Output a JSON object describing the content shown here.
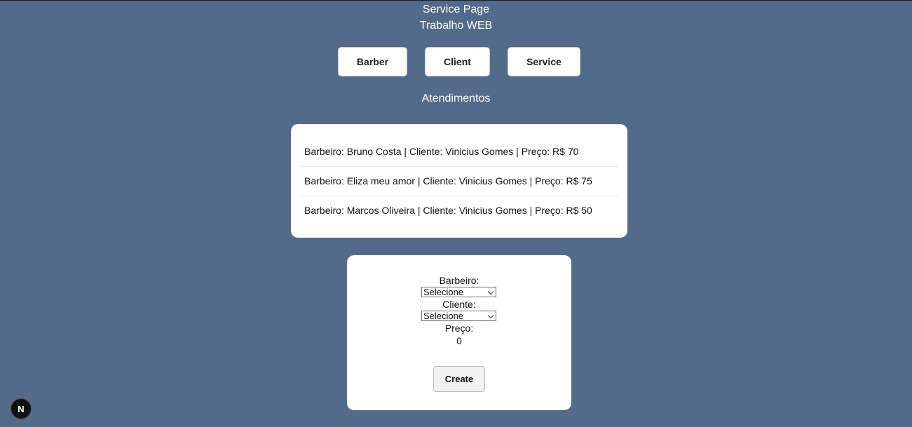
{
  "header": {
    "page_title": "Service Page",
    "subtitle": "Trabalho WEB"
  },
  "nav": {
    "barber_label": "Barber",
    "client_label": "Client",
    "service_label": "Service"
  },
  "section": {
    "title": "Atendimentos"
  },
  "services": [
    "Barbeiro: Bruno Costa | Cliente: Vinicius Gomes | Preço: R$ 70",
    "Barbeiro: Eliza meu amor | Cliente: Vinicius Gomes | Preço: R$ 75",
    "Barbeiro: Marcos Oliveira | Cliente: Vinicius Gomes | Preço: R$ 50"
  ],
  "form": {
    "barbeiro_label": "Barbeiro:",
    "barbeiro_selected": "Selecione",
    "cliente_label": "Cliente:",
    "cliente_selected": "Selecione",
    "preco_label": "Preço:",
    "preco_value": "0",
    "create_label": "Create"
  },
  "devtools": {
    "badge_letter": "N"
  },
  "colors": {
    "background": "#536a89",
    "card": "#ffffff"
  }
}
